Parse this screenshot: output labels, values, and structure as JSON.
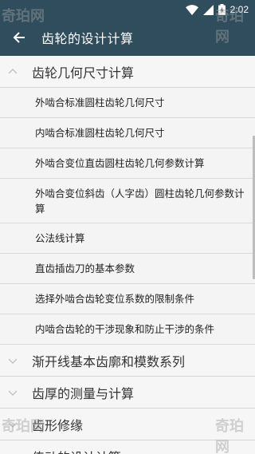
{
  "status": {
    "time": "2:02"
  },
  "header": {
    "title": "齿轮的设计计算"
  },
  "groups": [
    {
      "title": "齿轮几何尺寸计算",
      "items": [
        "外啮合标准圆柱齿轮几何尺寸",
        "内啮合标准圆柱齿轮几何尺寸",
        "外啮合变位直齿圆柱齿轮几何参数计算",
        "外啮合变位斜齿（人字齿）圆柱齿轮几何参数计算",
        "公法线计算",
        "直齿插齿刀的基本参数",
        "选择外啮合齿轮变位系数的限制条件",
        "内啮合齿轮的干涉现象和防止干涉的条件"
      ]
    },
    {
      "title": "渐开线基本齿廓和模数系列"
    },
    {
      "title": "齿厚的测量与计算"
    },
    {
      "title": "齿形修缘"
    },
    {
      "title": "传动的设计计算"
    }
  ],
  "watermark": "奇珀网"
}
